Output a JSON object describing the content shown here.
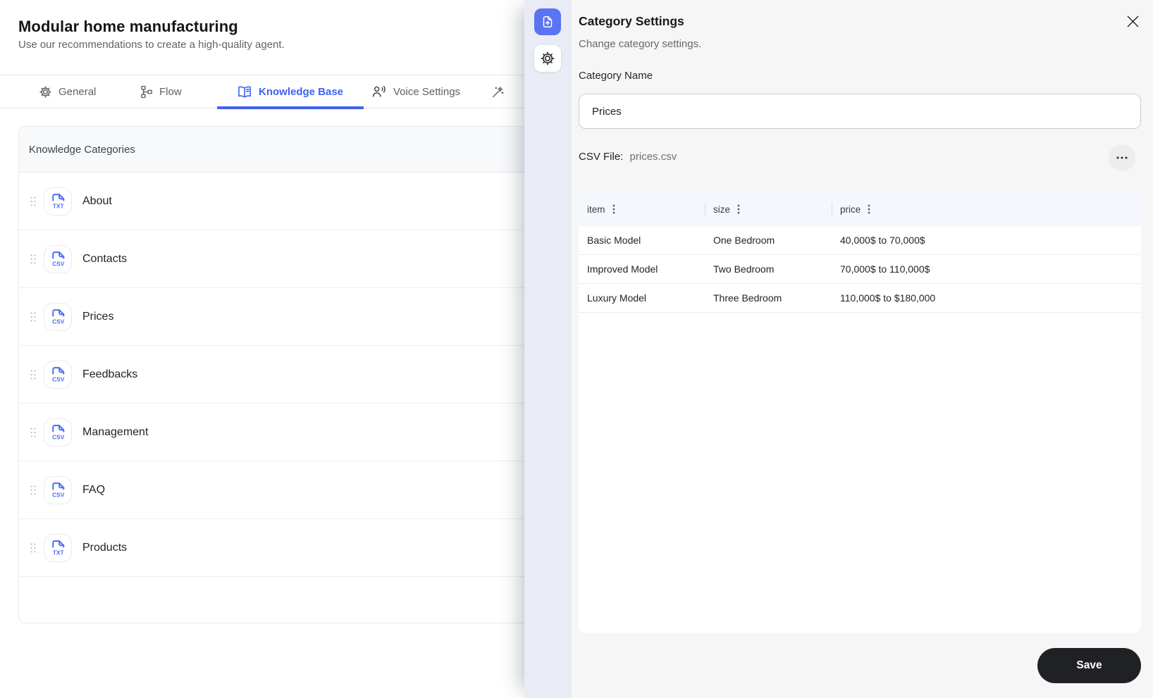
{
  "page": {
    "title": "Modular home manufacturing",
    "subtitle": "Use our recommendations to create a high-quality agent."
  },
  "tabs": [
    {
      "label": "General",
      "icon": "gear-icon",
      "active": false
    },
    {
      "label": "Flow",
      "icon": "flow-icon",
      "active": false
    },
    {
      "label": "Knowledge Base",
      "icon": "open-book-icon",
      "active": true
    },
    {
      "label": "Voice Settings",
      "icon": "voice-icon",
      "active": false
    },
    {
      "label": "",
      "icon": "magic-wand-icon",
      "active": false
    }
  ],
  "knowledge_list": {
    "header": "Knowledge Categories",
    "items": [
      {
        "label": "About",
        "file_type": "TXT"
      },
      {
        "label": "Contacts",
        "file_type": "CSV"
      },
      {
        "label": "Prices",
        "file_type": "CSV"
      },
      {
        "label": "Feedbacks",
        "file_type": "CSV"
      },
      {
        "label": "Management",
        "file_type": "CSV"
      },
      {
        "label": "FAQ",
        "file_type": "CSV"
      },
      {
        "label": "Products",
        "file_type": "TXT"
      }
    ]
  },
  "rail": {
    "buttons": [
      "file-upload-icon",
      "gear-icon"
    ]
  },
  "panel": {
    "title": "Category Settings",
    "subtitle": "Change category settings.",
    "category_name_label": "Category Name",
    "category_name_value": "Prices",
    "csv_file_label": "CSV File:",
    "csv_file_value": "prices.csv",
    "save_label": "Save",
    "table": {
      "columns": [
        "item",
        "size",
        "price"
      ],
      "rows": [
        [
          "Basic Model",
          "One Bedroom",
          "40,000$ to 70,000$"
        ],
        [
          "Improved Model",
          "Two Bedroom",
          "70,000$ to 110,000$"
        ],
        [
          "Luxury Model",
          "Three Bedroom",
          "110,000$ to $180,000"
        ]
      ]
    }
  },
  "colors": {
    "accent_blue": "#3f63f0",
    "rail_button_blue": "#5b74f3",
    "file_icon_blue": "#4a6cf6",
    "save_button_bg": "#202125",
    "panel_bg": "#f6f6f7",
    "rail_bg": "#e9ecf4",
    "table_header_bg": "#f4f7fc"
  }
}
